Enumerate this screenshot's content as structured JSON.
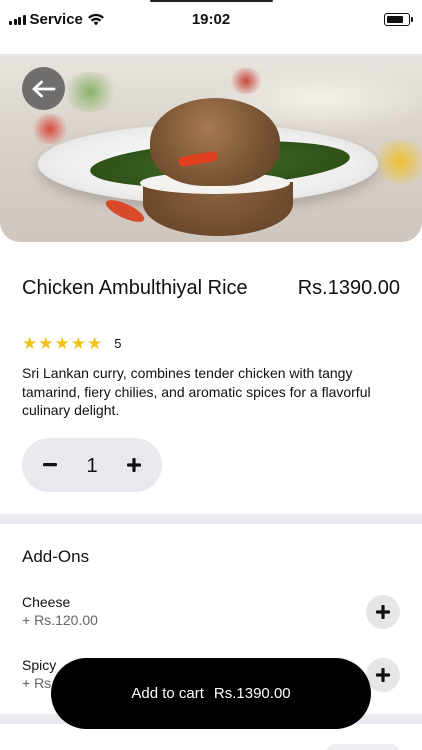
{
  "status_bar": {
    "carrier": "Service",
    "time": "19:02",
    "battery_level": 0.8
  },
  "product": {
    "back_icon": "arrow-left-icon",
    "name": "Chicken Ambulthiyal Rice",
    "price": "Rs.1390.00",
    "rating_stars": 5,
    "rating_count": "5",
    "description": "Sri Lankan curry, combines tender chicken with tangy tamarind, fiery chilies, and aromatic spices for a flavorful culinary delight."
  },
  "quantity": {
    "minus": "−",
    "value": "1",
    "plus": "+"
  },
  "addons": {
    "title": "Add-Ons",
    "items": [
      {
        "name": "Cheese",
        "price": "+ Rs.120.00",
        "add": "+"
      },
      {
        "name": "Spicy",
        "price": "+ Rs",
        "add": "+"
      }
    ]
  },
  "cart": {
    "label": "Add to cart",
    "total": "Rs.1390.00"
  },
  "colors": {
    "star": "#f2c21b",
    "cart_bg": "#000000",
    "divider": "#e8eaef",
    "stepper_bg": "#e7e9ee"
  }
}
